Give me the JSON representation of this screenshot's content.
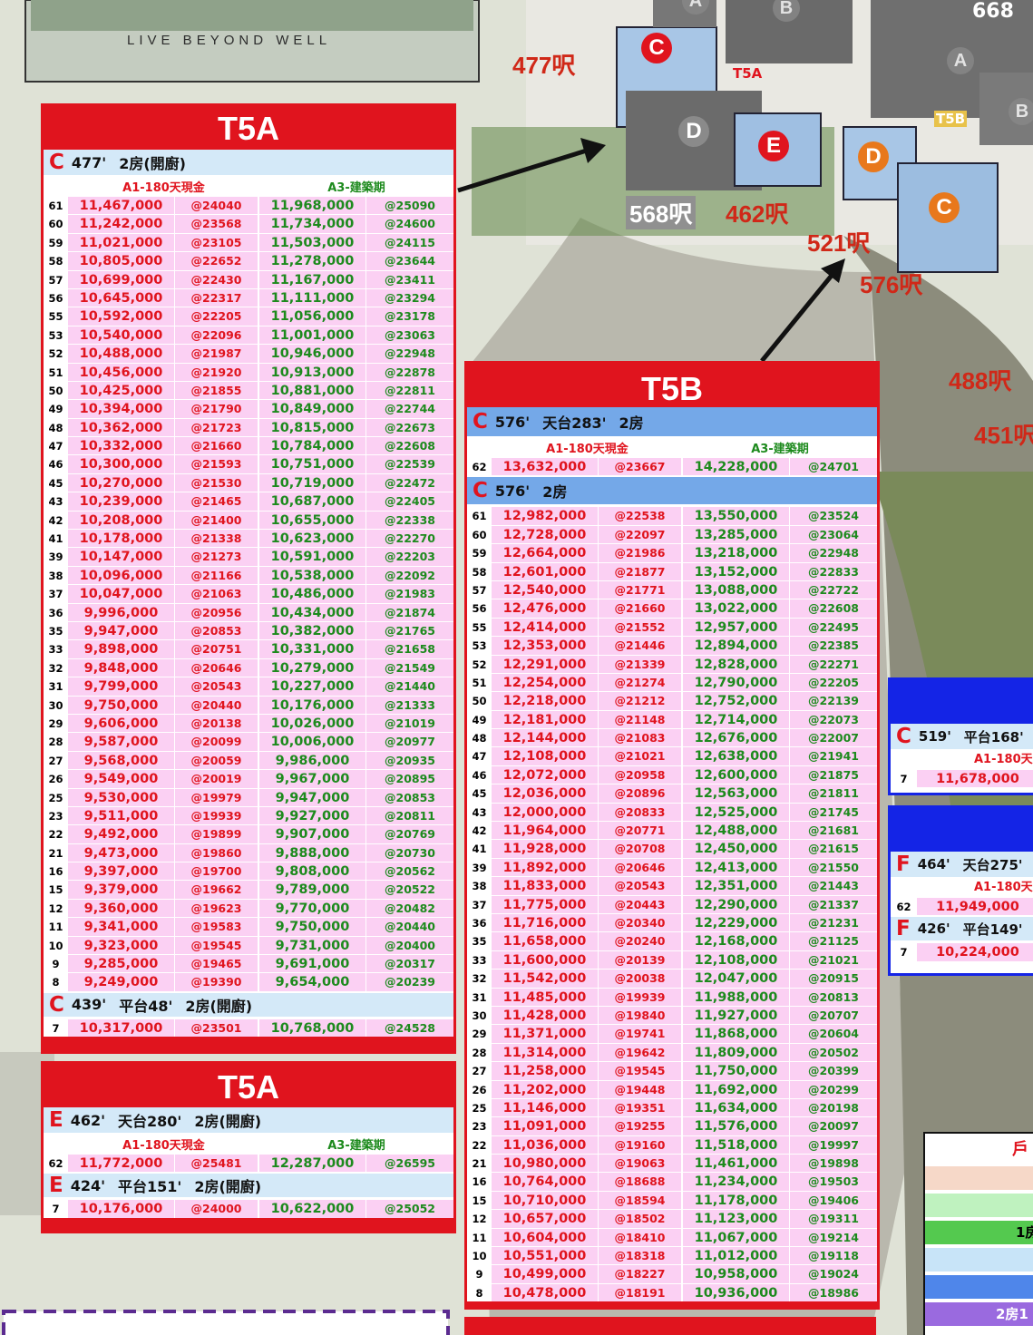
{
  "slogan": "LIVE BEYOND WELL",
  "map_labels": [
    "477呎",
    "568呎",
    "462呎",
    "521呎",
    "576呎",
    "488呎",
    "451呎",
    "T5A",
    "T5B",
    "668"
  ],
  "map_circles": {
    "c1": "C",
    "e": "E",
    "d1": "D",
    "d2": "D",
    "c2": "C",
    "a1": "A",
    "b1": "B",
    "a2": "A",
    "b2": "B"
  },
  "col_a1": "A1-180天現金",
  "col_a3": "A3-建築期",
  "panel1": {
    "title": "T5A",
    "sec1": {
      "letter": "C",
      "size": "477'",
      "rooms": "2房(開廚)",
      "rows": [
        [
          "61",
          "11,467,000",
          "@24040",
          "11,968,000",
          "@25090"
        ],
        [
          "60",
          "11,242,000",
          "@23568",
          "11,734,000",
          "@24600"
        ],
        [
          "59",
          "11,021,000",
          "@23105",
          "11,503,000",
          "@24115"
        ],
        [
          "58",
          "10,805,000",
          "@22652",
          "11,278,000",
          "@23644"
        ],
        [
          "57",
          "10,699,000",
          "@22430",
          "11,167,000",
          "@23411"
        ],
        [
          "56",
          "10,645,000",
          "@22317",
          "11,111,000",
          "@23294"
        ],
        [
          "55",
          "10,592,000",
          "@22205",
          "11,056,000",
          "@23178"
        ],
        [
          "53",
          "10,540,000",
          "@22096",
          "11,001,000",
          "@23063"
        ],
        [
          "52",
          "10,488,000",
          "@21987",
          "10,946,000",
          "@22948"
        ],
        [
          "51",
          "10,456,000",
          "@21920",
          "10,913,000",
          "@22878"
        ],
        [
          "50",
          "10,425,000",
          "@21855",
          "10,881,000",
          "@22811"
        ],
        [
          "49",
          "10,394,000",
          "@21790",
          "10,849,000",
          "@22744"
        ],
        [
          "48",
          "10,362,000",
          "@21723",
          "10,815,000",
          "@22673"
        ],
        [
          "47",
          "10,332,000",
          "@21660",
          "10,784,000",
          "@22608"
        ],
        [
          "46",
          "10,300,000",
          "@21593",
          "10,751,000",
          "@22539"
        ],
        [
          "45",
          "10,270,000",
          "@21530",
          "10,719,000",
          "@22472"
        ],
        [
          "43",
          "10,239,000",
          "@21465",
          "10,687,000",
          "@22405"
        ],
        [
          "42",
          "10,208,000",
          "@21400",
          "10,655,000",
          "@22338"
        ],
        [
          "41",
          "10,178,000",
          "@21338",
          "10,623,000",
          "@22270"
        ],
        [
          "39",
          "10,147,000",
          "@21273",
          "10,591,000",
          "@22203"
        ],
        [
          "38",
          "10,096,000",
          "@21166",
          "10,538,000",
          "@22092"
        ],
        [
          "37",
          "10,047,000",
          "@21063",
          "10,486,000",
          "@21983"
        ],
        [
          "36",
          "9,996,000",
          "@20956",
          "10,434,000",
          "@21874"
        ],
        [
          "35",
          "9,947,000",
          "@20853",
          "10,382,000",
          "@21765"
        ],
        [
          "33",
          "9,898,000",
          "@20751",
          "10,331,000",
          "@21658"
        ],
        [
          "32",
          "9,848,000",
          "@20646",
          "10,279,000",
          "@21549"
        ],
        [
          "31",
          "9,799,000",
          "@20543",
          "10,227,000",
          "@21440"
        ],
        [
          "30",
          "9,750,000",
          "@20440",
          "10,176,000",
          "@21333"
        ],
        [
          "29",
          "9,606,000",
          "@20138",
          "10,026,000",
          "@21019"
        ],
        [
          "28",
          "9,587,000",
          "@20099",
          "10,006,000",
          "@20977"
        ],
        [
          "27",
          "9,568,000",
          "@20059",
          "9,986,000",
          "@20935"
        ],
        [
          "26",
          "9,549,000",
          "@20019",
          "9,967,000",
          "@20895"
        ],
        [
          "25",
          "9,530,000",
          "@19979",
          "9,947,000",
          "@20853"
        ],
        [
          "23",
          "9,511,000",
          "@19939",
          "9,927,000",
          "@20811"
        ],
        [
          "22",
          "9,492,000",
          "@19899",
          "9,907,000",
          "@20769"
        ],
        [
          "21",
          "9,473,000",
          "@19860",
          "9,888,000",
          "@20730"
        ],
        [
          "16",
          "9,397,000",
          "@19700",
          "9,808,000",
          "@20562"
        ],
        [
          "15",
          "9,379,000",
          "@19662",
          "9,789,000",
          "@20522"
        ],
        [
          "12",
          "9,360,000",
          "@19623",
          "9,770,000",
          "@20482"
        ],
        [
          "11",
          "9,341,000",
          "@19583",
          "9,750,000",
          "@20440"
        ],
        [
          "10",
          "9,323,000",
          "@19545",
          "9,731,000",
          "@20400"
        ],
        [
          "9",
          "9,285,000",
          "@19465",
          "9,691,000",
          "@20317"
        ],
        [
          "8",
          "9,249,000",
          "@19390",
          "9,654,000",
          "@20239"
        ]
      ]
    },
    "sec2": {
      "letter": "C",
      "size": "439'",
      "extra": "平台48'",
      "rooms": "2房(開廚)",
      "rows": [
        [
          "7",
          "10,317,000",
          "@23501",
          "10,768,000",
          "@24528"
        ]
      ]
    }
  },
  "panel2": {
    "title": "T5A",
    "sec1": {
      "letter": "E",
      "size": "462'",
      "extra": "天台280'",
      "rooms": "2房(開廚)",
      "rows": [
        [
          "62",
          "11,772,000",
          "@25481",
          "12,287,000",
          "@26595"
        ]
      ]
    },
    "sec2": {
      "letter": "E",
      "size": "424'",
      "extra": "平台151'",
      "rooms": "2房(開廚)",
      "rows": [
        [
          "7",
          "10,176,000",
          "@24000",
          "10,622,000",
          "@25052"
        ]
      ]
    }
  },
  "panel3": {
    "title": "T5B",
    "sec1": {
      "letter": "C",
      "size": "576'",
      "extra": "天台283'",
      "rooms": "2房",
      "rows": [
        [
          "62",
          "13,632,000",
          "@23667",
          "14,228,000",
          "@24701"
        ]
      ]
    },
    "sec2": {
      "letter": "C",
      "size": "576'",
      "rooms": "2房",
      "rows": [
        [
          "61",
          "12,982,000",
          "@22538",
          "13,550,000",
          "@23524"
        ],
        [
          "60",
          "12,728,000",
          "@22097",
          "13,285,000",
          "@23064"
        ],
        [
          "59",
          "12,664,000",
          "@21986",
          "13,218,000",
          "@22948"
        ],
        [
          "58",
          "12,601,000",
          "@21877",
          "13,152,000",
          "@22833"
        ],
        [
          "57",
          "12,540,000",
          "@21771",
          "13,088,000",
          "@22722"
        ],
        [
          "56",
          "12,476,000",
          "@21660",
          "13,022,000",
          "@22608"
        ],
        [
          "55",
          "12,414,000",
          "@21552",
          "12,957,000",
          "@22495"
        ],
        [
          "53",
          "12,353,000",
          "@21446",
          "12,894,000",
          "@22385"
        ],
        [
          "52",
          "12,291,000",
          "@21339",
          "12,828,000",
          "@22271"
        ],
        [
          "51",
          "12,254,000",
          "@21274",
          "12,790,000",
          "@22205"
        ],
        [
          "50",
          "12,218,000",
          "@21212",
          "12,752,000",
          "@22139"
        ],
        [
          "49",
          "12,181,000",
          "@21148",
          "12,714,000",
          "@22073"
        ],
        [
          "48",
          "12,144,000",
          "@21083",
          "12,676,000",
          "@22007"
        ],
        [
          "47",
          "12,108,000",
          "@21021",
          "12,638,000",
          "@21941"
        ],
        [
          "46",
          "12,072,000",
          "@20958",
          "12,600,000",
          "@21875"
        ],
        [
          "45",
          "12,036,000",
          "@20896",
          "12,563,000",
          "@21811"
        ],
        [
          "43",
          "12,000,000",
          "@20833",
          "12,525,000",
          "@21745"
        ],
        [
          "42",
          "11,964,000",
          "@20771",
          "12,488,000",
          "@21681"
        ],
        [
          "41",
          "11,928,000",
          "@20708",
          "12,450,000",
          "@21615"
        ],
        [
          "39",
          "11,892,000",
          "@20646",
          "12,413,000",
          "@21550"
        ],
        [
          "38",
          "11,833,000",
          "@20543",
          "12,351,000",
          "@21443"
        ],
        [
          "37",
          "11,775,000",
          "@20443",
          "12,290,000",
          "@21337"
        ],
        [
          "36",
          "11,716,000",
          "@20340",
          "12,229,000",
          "@21231"
        ],
        [
          "35",
          "11,658,000",
          "@20240",
          "12,168,000",
          "@21125"
        ],
        [
          "33",
          "11,600,000",
          "@20139",
          "12,108,000",
          "@21021"
        ],
        [
          "32",
          "11,542,000",
          "@20038",
          "12,047,000",
          "@20915"
        ],
        [
          "31",
          "11,485,000",
          "@19939",
          "11,988,000",
          "@20813"
        ],
        [
          "30",
          "11,428,000",
          "@19840",
          "11,927,000",
          "@20707"
        ],
        [
          "29",
          "11,371,000",
          "@19741",
          "11,868,000",
          "@20604"
        ],
        [
          "28",
          "11,314,000",
          "@19642",
          "11,809,000",
          "@20502"
        ],
        [
          "27",
          "11,258,000",
          "@19545",
          "11,750,000",
          "@20399"
        ],
        [
          "26",
          "11,202,000",
          "@19448",
          "11,692,000",
          "@20299"
        ],
        [
          "25",
          "11,146,000",
          "@19351",
          "11,634,000",
          "@20198"
        ],
        [
          "23",
          "11,091,000",
          "@19255",
          "11,576,000",
          "@20097"
        ],
        [
          "22",
          "11,036,000",
          "@19160",
          "11,518,000",
          "@19997"
        ],
        [
          "21",
          "10,980,000",
          "@19063",
          "11,461,000",
          "@19898"
        ],
        [
          "16",
          "10,764,000",
          "@18688",
          "11,234,000",
          "@19503"
        ],
        [
          "15",
          "10,710,000",
          "@18594",
          "11,178,000",
          "@19406"
        ],
        [
          "12",
          "10,657,000",
          "@18502",
          "11,123,000",
          "@19311"
        ],
        [
          "11",
          "10,604,000",
          "@18410",
          "11,067,000",
          "@19214"
        ],
        [
          "10",
          "10,551,000",
          "@18318",
          "11,012,000",
          "@19118"
        ],
        [
          "9",
          "10,499,000",
          "@18227",
          "10,958,000",
          "@19024"
        ],
        [
          "8",
          "10,478,000",
          "@18191",
          "10,936,000",
          "@18986"
        ]
      ]
    }
  },
  "side1": {
    "letter": "C",
    "size": "519'",
    "extra": "平台168'",
    "col": "A1-180天",
    "row": [
      "7",
      "11,678,000"
    ]
  },
  "side2": {
    "letter": "F",
    "size": "464'",
    "extra": "天台275'",
    "col": "A1-180天",
    "row": [
      "62",
      "11,949,000"
    ],
    "sec2": {
      "letter": "F",
      "size": "426'",
      "extra": "平台149'",
      "row": [
        "7",
        "10,224,000"
      ]
    }
  },
  "legend": {
    "head": "戶",
    "r1": "1房",
    "r2": "2房1"
  }
}
